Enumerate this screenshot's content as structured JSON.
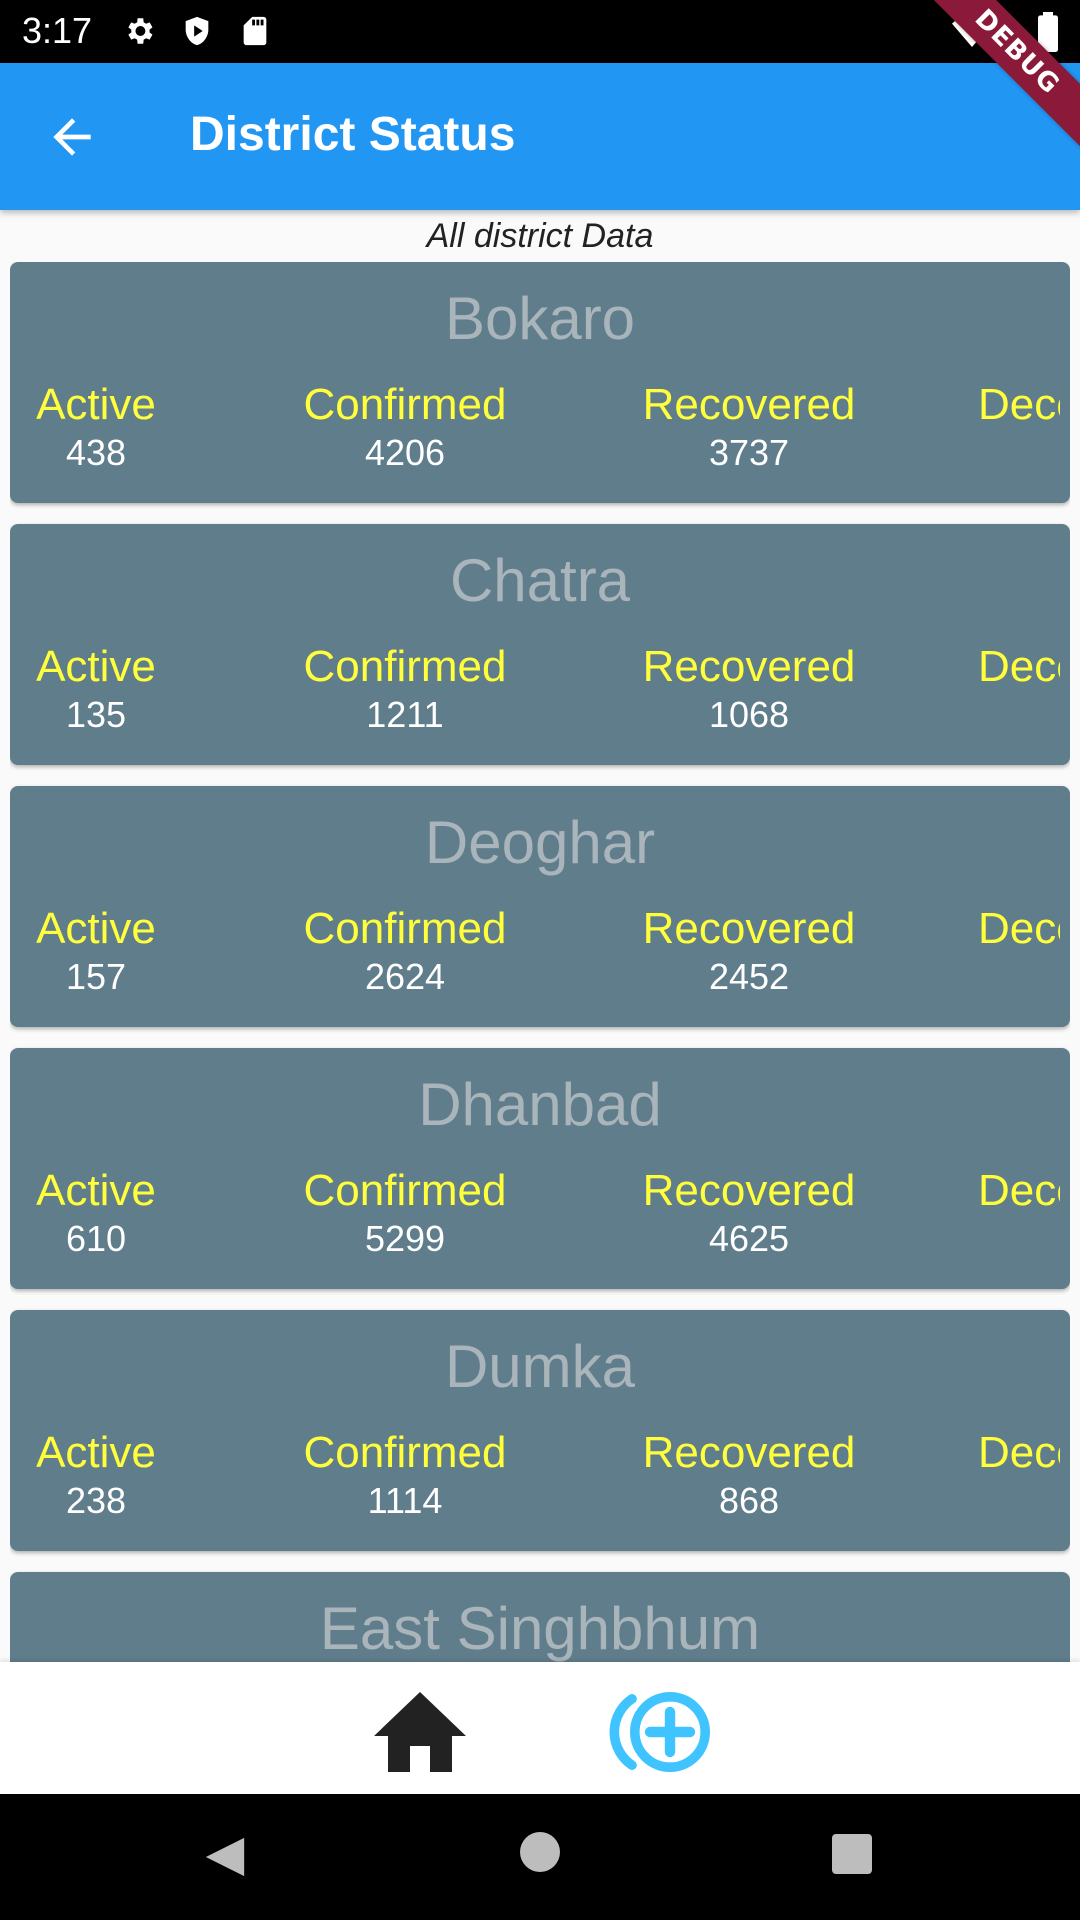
{
  "status_bar": {
    "time": "3:17",
    "icons": [
      "gear-icon",
      "play-shield-icon",
      "sd-card-icon",
      "wifi-icon",
      "battery-icon"
    ]
  },
  "debug_banner": "DEBUG",
  "app_bar": {
    "title": "District Status",
    "back_icon": "arrow-back-icon",
    "color": "#2196f3"
  },
  "subtitle": "All district Data",
  "labels": {
    "active": "Active",
    "confirmed": "Confirmed",
    "recovered": "Recovered",
    "deceased": "Deceased"
  },
  "colors": {
    "card": "#607d8b",
    "label": "#ffff3c",
    "value": "#ffffff",
    "district_name": "#a9b4bb"
  },
  "districts": [
    {
      "name": "Bokaro",
      "active": "438",
      "confirmed": "4206",
      "recovered": "3737"
    },
    {
      "name": "Chatra",
      "active": "135",
      "confirmed": "1211",
      "recovered": "1068"
    },
    {
      "name": "Deoghar",
      "active": "157",
      "confirmed": "2624",
      "recovered": "2452"
    },
    {
      "name": "Dhanbad",
      "active": "610",
      "confirmed": "5299",
      "recovered": "4625"
    },
    {
      "name": "Dumka",
      "active": "238",
      "confirmed": "1114",
      "recovered": "868"
    },
    {
      "name": "East Singhbhum"
    }
  ],
  "bottom_nav": {
    "items": [
      "home-icon",
      "add-circle-icon"
    ]
  },
  "system_nav": [
    "back-triangle-icon",
    "home-circle-icon",
    "recents-square-icon"
  ]
}
